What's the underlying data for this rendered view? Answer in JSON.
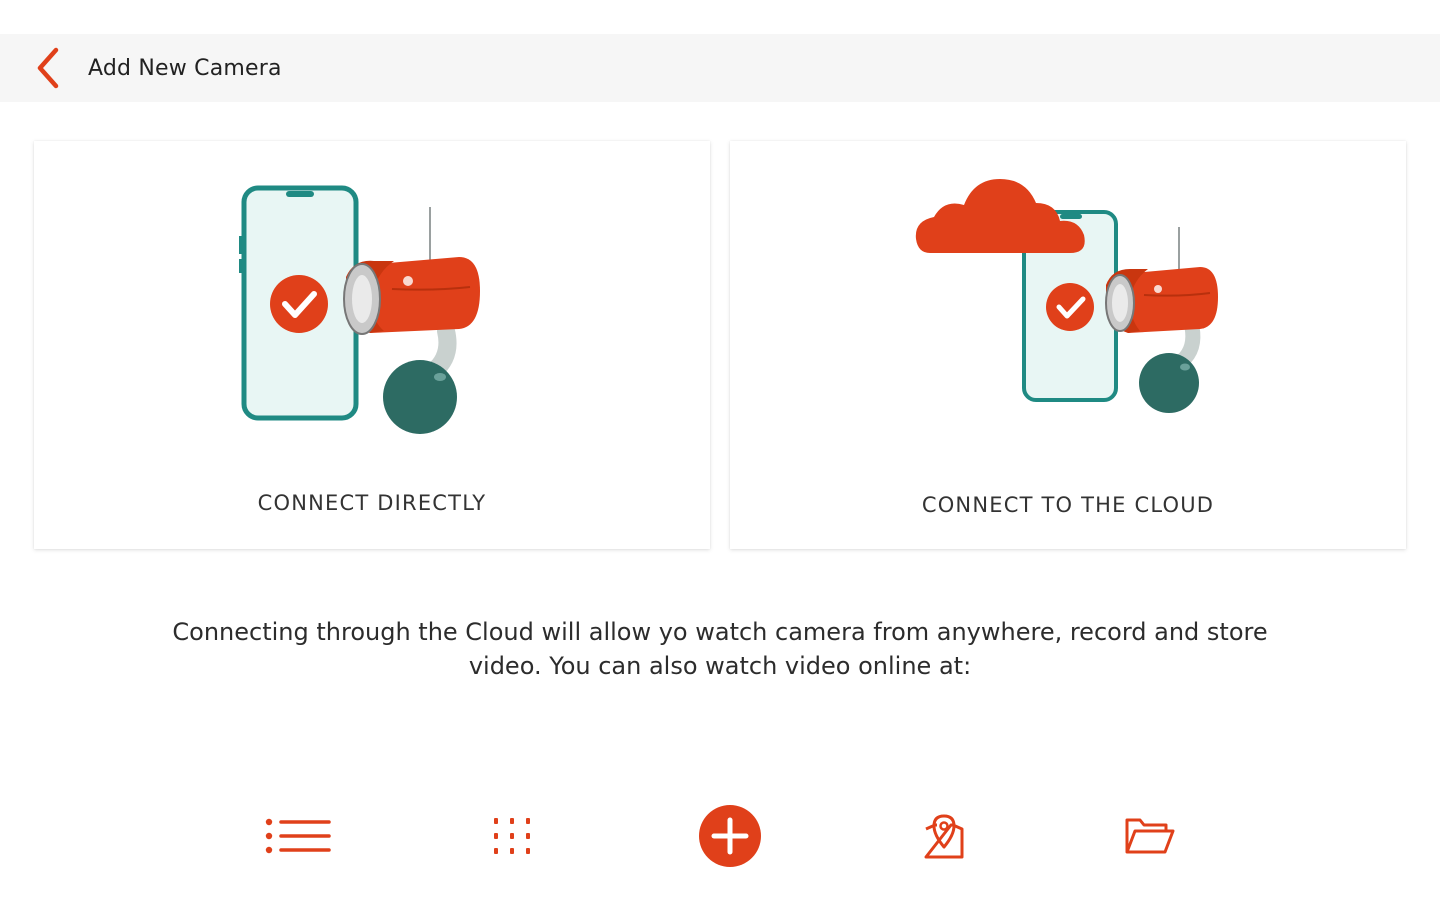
{
  "header": {
    "title": "Add New Camera",
    "back_icon": "chevron-left-icon"
  },
  "options": [
    {
      "label": "CONNECT DIRECTLY",
      "illustration": "phone-camera-illustration"
    },
    {
      "label": "CONNECT TO THE CLOUD",
      "illustration": "cloud-phone-camera-illustration"
    }
  ],
  "info_text": "Connecting through the Cloud will allow yo watch camera from anywhere, record and store video. You can also watch video online at:",
  "bottom_nav": [
    {
      "icon": "list-icon"
    },
    {
      "icon": "grid-icon"
    },
    {
      "icon": "add-icon"
    },
    {
      "icon": "map-pin-icon"
    },
    {
      "icon": "folder-icon"
    }
  ],
  "colors": {
    "accent": "#e0401a",
    "teal": "#1f8a83",
    "dark_teal": "#2d6b63",
    "header_bg": "#f6f6f6"
  }
}
